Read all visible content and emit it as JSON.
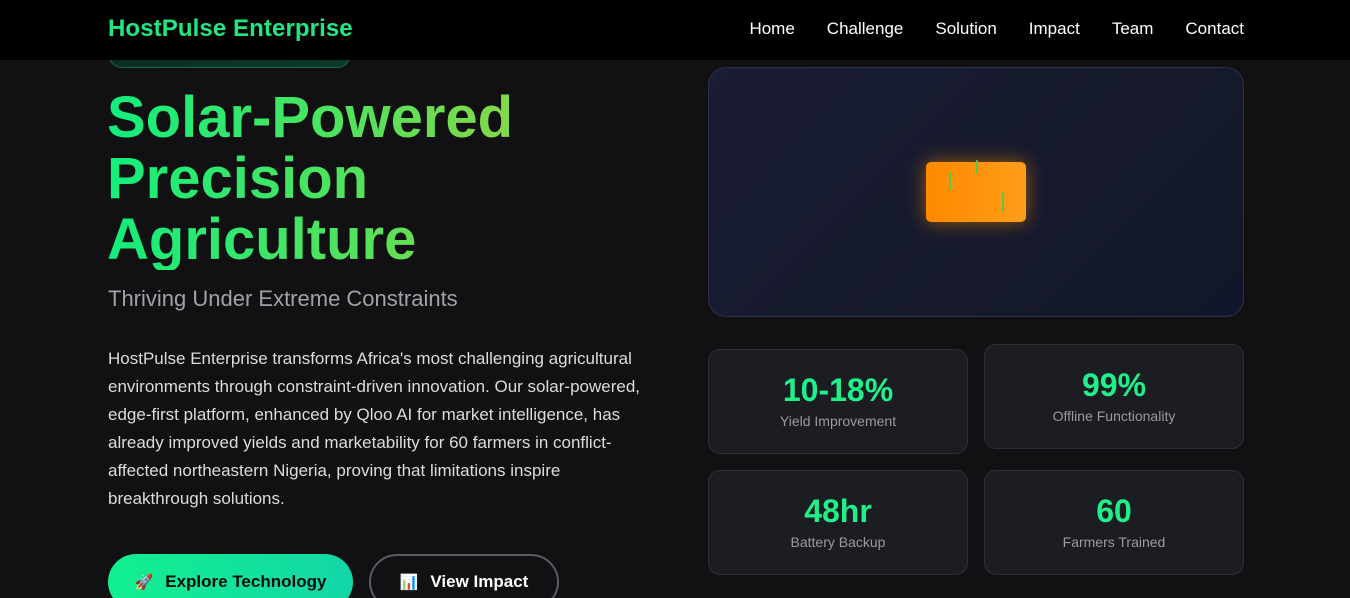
{
  "nav": {
    "brand": "HostPulse Enterprise",
    "links": [
      "Home",
      "Challenge",
      "Solution",
      "Impact",
      "Team",
      "Contact"
    ]
  },
  "hero": {
    "title_lines": [
      "Solar-Powered",
      "Precision",
      "Agriculture"
    ],
    "subtitle": "Thriving Under Extreme Constraints",
    "description": "HostPulse Enterprise transforms Africa's most challenging agricultural environments through constraint-driven innovation. Our solar-powered, edge-first platform, enhanced by Qloo AI for market intelligence, has already improved yields and marketability for 60 farmers in conflict-affected northeastern Nigeria, proving that limitations inspire breakthrough solutions.",
    "primary_button": {
      "icon": "🚀",
      "label": "Explore Technology"
    },
    "secondary_button": {
      "icon": "📊",
      "label": "View Impact"
    }
  },
  "stats": [
    {
      "value": "10-18%",
      "label": "Yield Improvement"
    },
    {
      "value": "99%",
      "label": "Offline Functionality"
    },
    {
      "value": "48hr",
      "label": "Battery Backup"
    },
    {
      "value": "60",
      "label": "Farmers Trained"
    }
  ],
  "colors": {
    "accent": "#1ef08a",
    "solar": "#ff8a00",
    "background": "#111114"
  },
  "icons": {
    "primary_button": "rocket-icon",
    "secondary_button": "bar-chart-icon",
    "visual": "solar-panel-icon"
  }
}
